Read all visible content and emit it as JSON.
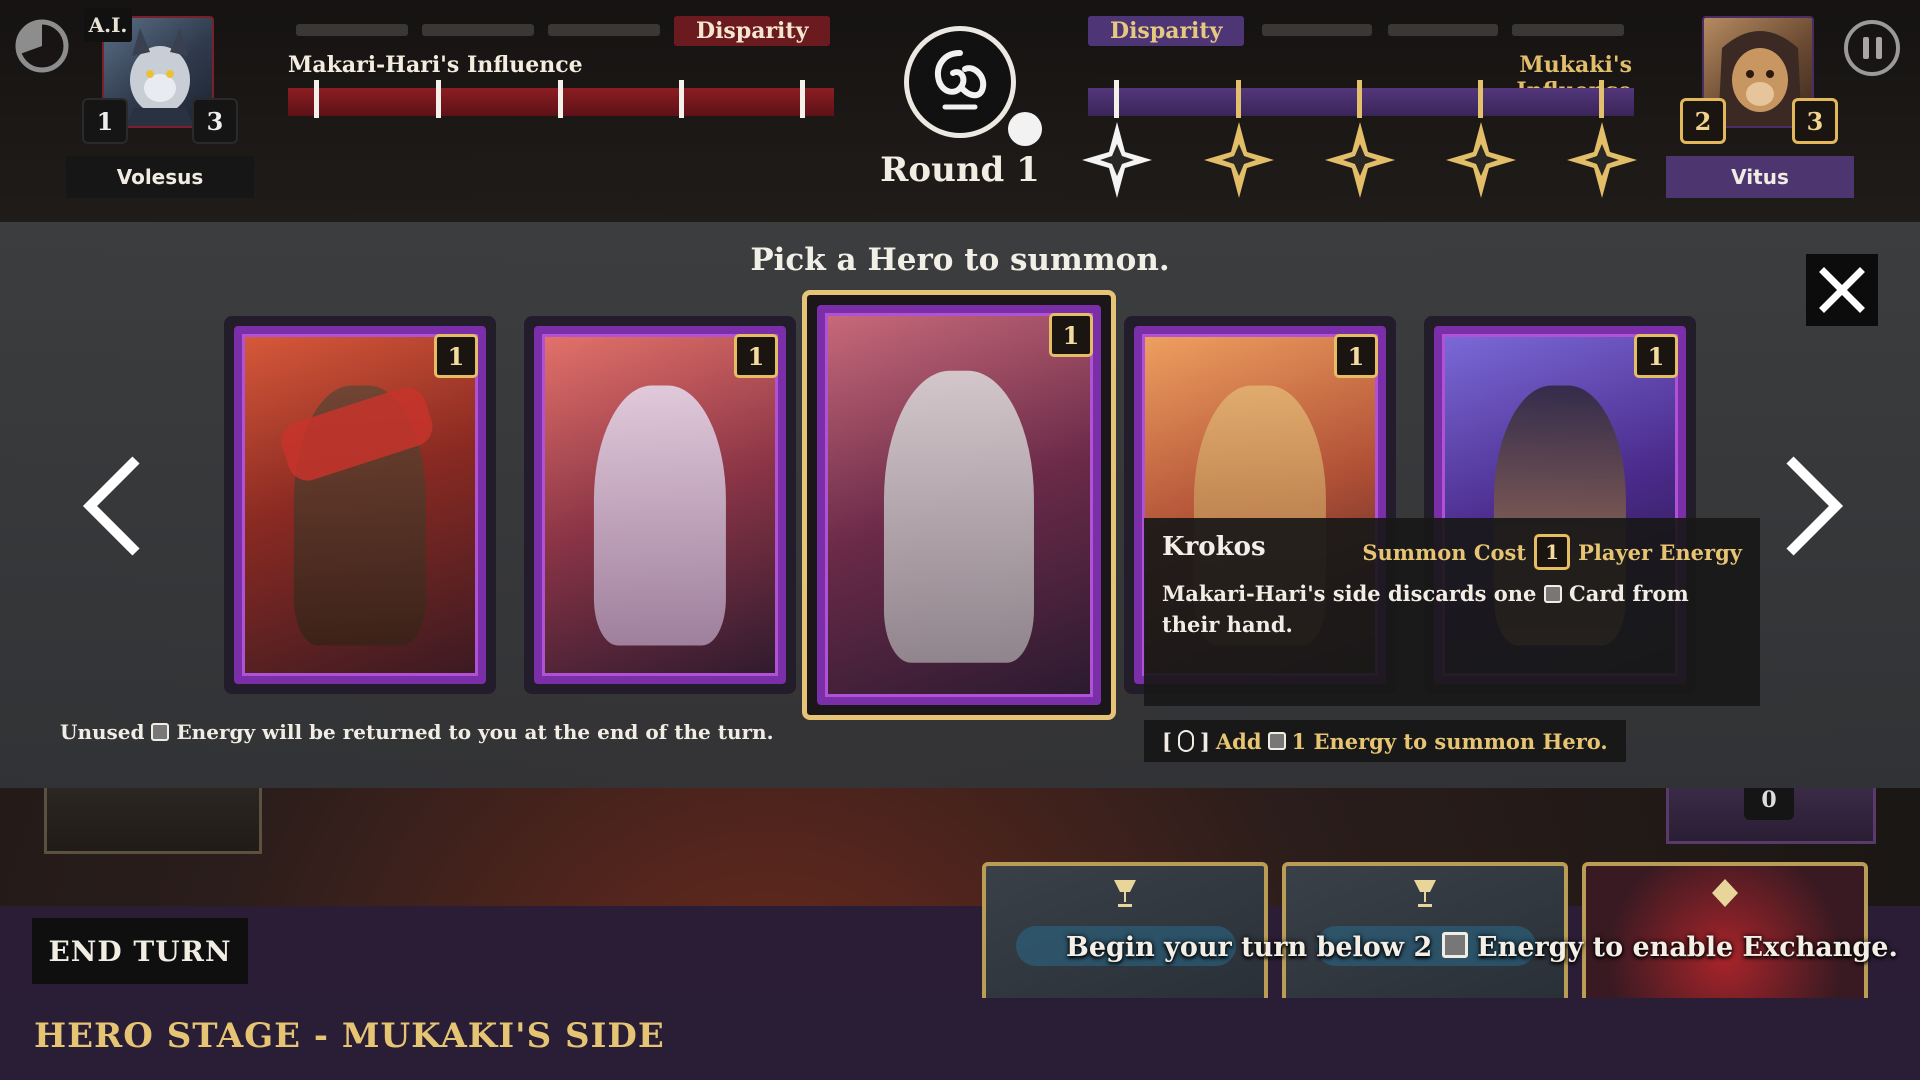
{
  "left_player": {
    "ai_tag": "A.I.",
    "name": "Volesus",
    "count_a": "1",
    "count_b": "3"
  },
  "right_player": {
    "name": "Vitus",
    "count_a": "2",
    "count_b": "3"
  },
  "disparity_left": "Disparity",
  "disparity_right": "Disparity",
  "influence_left": "Makari-Hari's Influence",
  "influence_right": "Mukaki's Influence",
  "round_label": "Round 1",
  "picker": {
    "title": "Pick a Hero to summon.",
    "cards": [
      {
        "cost": "1",
        "palette": "red"
      },
      {
        "cost": "1",
        "palette": "white"
      },
      {
        "cost": "1",
        "palette": "leopard",
        "selected": true
      },
      {
        "cost": "1",
        "palette": "orange"
      },
      {
        "cost": "1",
        "palette": "violet"
      }
    ],
    "tooltip": {
      "name": "Krokos",
      "cost_label": "Summon Cost",
      "cost_value": "1",
      "cost_suffix": "Player Energy",
      "desc_before": "Makari-Hari's side discards one",
      "desc_after": "Card from their hand."
    },
    "hint_bracket_open": "[",
    "hint_bracket_close": "]",
    "hint_add": "Add",
    "hint_rest": "1 Energy to summon Hero.",
    "unused_before": "Unused",
    "unused_after": "Energy will be returned to you at the end of the turn."
  },
  "deck_count": "0",
  "end_turn": "END TURN",
  "exchange_before": "Begin your turn below 2",
  "exchange_after": "Energy to enable Exchange.",
  "stage": "HERO STAGE - MUKAKI'S SIDE",
  "colors": {
    "gold": "#e5bd62",
    "crimson": "#8c1d22",
    "violet": "#53377b"
  }
}
